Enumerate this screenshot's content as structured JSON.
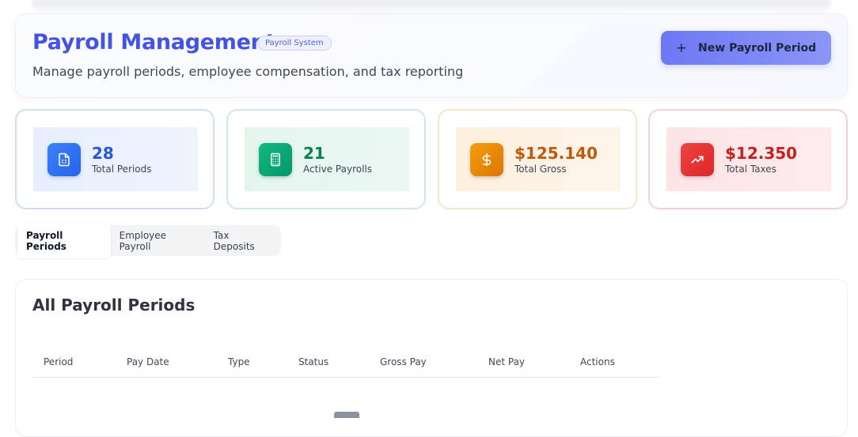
{
  "header": {
    "title": "Payroll Management",
    "badge": "Payroll System",
    "subtitle": "Manage payroll periods, employee compensation, and tax reporting",
    "new_button": "New Payroll Period",
    "new_button_icon": "plus-icon"
  },
  "stats": [
    {
      "value": "28",
      "label": "Total Periods",
      "icon": "document-icon",
      "color": "#2563eb"
    },
    {
      "value": "21",
      "label": "Active Payrolls",
      "icon": "calculator-icon",
      "color": "#059669"
    },
    {
      "value": "$125.140",
      "label": "Total Gross",
      "icon": "dollar-icon",
      "color": "#d97706"
    },
    {
      "value": "$12.350",
      "label": "Total Taxes",
      "icon": "trending-up-icon",
      "color": "#dc2626"
    }
  ],
  "tabs": [
    {
      "label": "Payroll Periods",
      "active": true
    },
    {
      "label": "Employee Payroll",
      "active": false
    },
    {
      "label": "Tax Deposits",
      "active": false
    }
  ],
  "table": {
    "title": "All Payroll Periods",
    "columns": [
      "Period",
      "Pay Date",
      "Type",
      "Status",
      "Gross Pay",
      "Net Pay",
      "Actions"
    ]
  }
}
